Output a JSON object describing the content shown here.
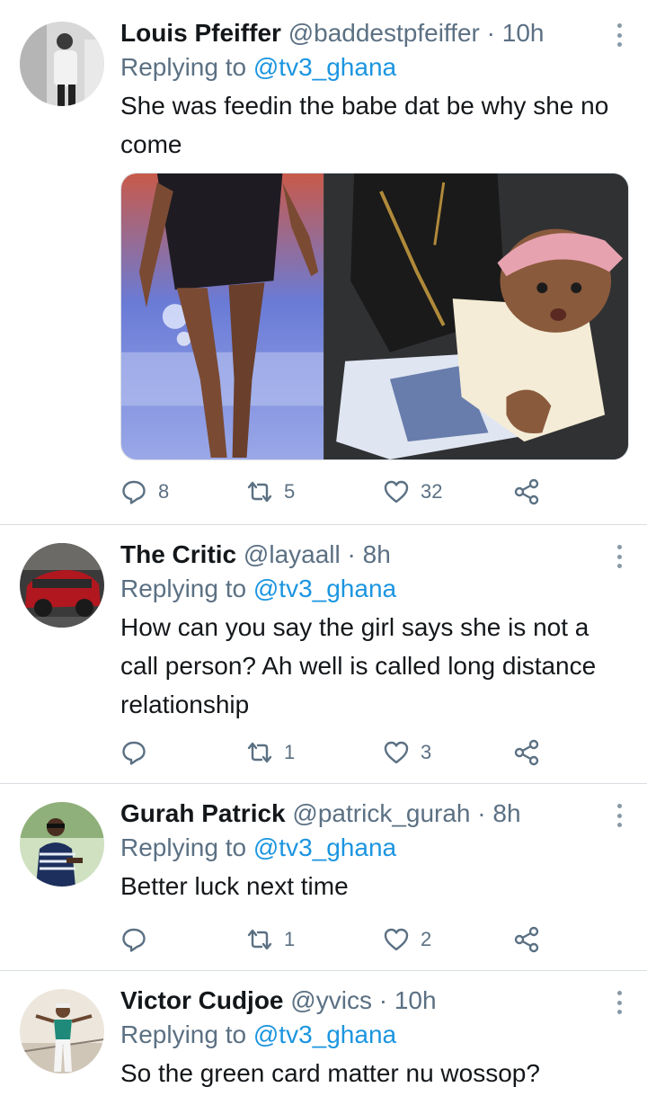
{
  "colors": {
    "link": "#1b95e0",
    "muted": "#5b7083",
    "text": "#14171a"
  },
  "tweets": [
    {
      "name": "Louis Pfeiffer",
      "handle": "@baddestpfeiffer",
      "dot": "·",
      "time": "10h",
      "replying_prefix": "Replying to",
      "replying_handle": "@tv3_ghana",
      "text": "She was feedin the babe dat be why she no come",
      "replies": "8",
      "retweets": "5",
      "likes": "32"
    },
    {
      "name": "The Critic",
      "handle": "@layaall",
      "dot": "·",
      "time": "8h",
      "replying_prefix": "Replying to",
      "replying_handle": "@tv3_ghana",
      "text": "How can you say the girl says she is not a call person? Ah well is called long distance relationship",
      "replies": "",
      "retweets": "1",
      "likes": "3"
    },
    {
      "name": "Gurah Patrick",
      "handle": "@patrick_gurah",
      "dot": "·",
      "time": "8h",
      "replying_prefix": "Replying to",
      "replying_handle": "@tv3_ghana",
      "text": "Better luck next time",
      "replies": "",
      "retweets": "1",
      "likes": "2"
    },
    {
      "name": "Victor Cudjoe",
      "handle": "@yvics",
      "dot": "·",
      "time": "10h",
      "replying_prefix": "Replying to",
      "replying_handle": "@tv3_ghana",
      "text": "So the green card matter nu wossop?"
    }
  ]
}
